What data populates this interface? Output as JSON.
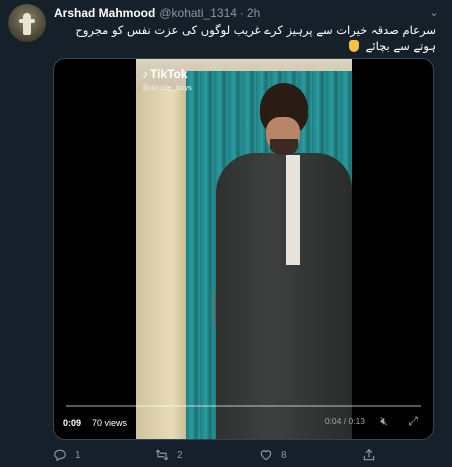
{
  "tweet": {
    "author_name": "Arshad Mahmood",
    "handle": "@kohati_1314",
    "separator": "·",
    "time": "2h",
    "text": "سرعام صدقہ خیرات سے پرہیز کرے   غریب لوگوں کی عزت نفس کو مجروح ہوتے سے بچائے",
    "menu_icon": "chevron-down-icon"
  },
  "video": {
    "watermark_brand": "TikTok",
    "watermark_user": "@dimple_boys",
    "elapsed": "0:09",
    "views": "70 views",
    "time_display": "0:04 / 0:13",
    "progress_fraction": 0.69
  },
  "actions": {
    "reply_count": "1",
    "retweet_count": "2",
    "like_count": "8"
  },
  "colors": {
    "background": "#15202b",
    "secondary_text": "#8899a6",
    "emoji": "#f6c042"
  }
}
